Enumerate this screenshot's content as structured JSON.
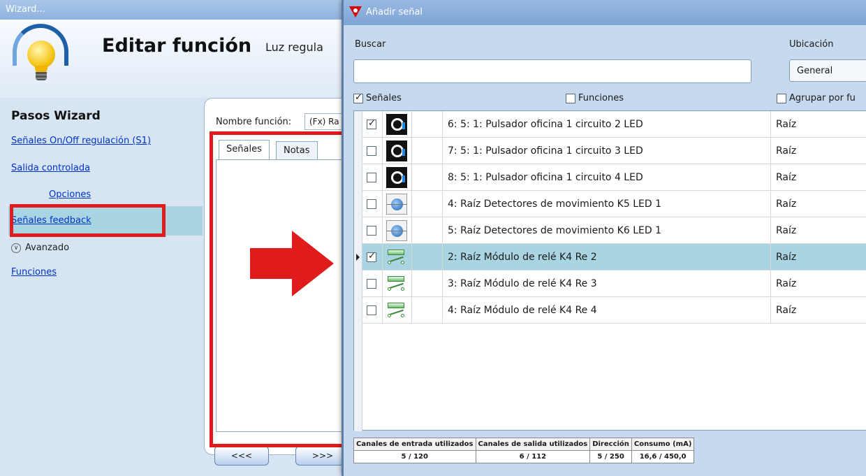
{
  "wizard": {
    "window_title": "Wizard...",
    "header_title": "Editar función",
    "header_subtitle": "Luz regula",
    "steps_title": "Pasos Wizard",
    "steps": [
      {
        "label": "Señales On/Off regulación (S1)"
      },
      {
        "label": "Salida controlada"
      },
      {
        "label": "Opciones"
      },
      {
        "label": "Señales feedback"
      }
    ],
    "advanced_label": "Avanzado",
    "functions_link": "Funciones",
    "function_name_label": "Nombre función:",
    "function_name_value": "(Fx) Ra",
    "tabs": [
      {
        "label": "Señales"
      },
      {
        "label": "Notas"
      }
    ],
    "back_button": "<<<",
    "next_button": ">>>"
  },
  "dialog": {
    "title": "Añadir señal",
    "search_label": "Buscar",
    "search_value": "",
    "location_label": "Ubicación",
    "location_value": "General",
    "filters": {
      "signals": {
        "label": "Señales",
        "checked": true
      },
      "functions": {
        "label": "Funciones",
        "checked": false
      },
      "group": {
        "label": "Agrupar por fu",
        "checked": false
      }
    },
    "rows": [
      {
        "checked": true,
        "icon": "pushbutton-icon",
        "name": "6: 5: 1: Pulsador oficina 1 circuito 2 LED",
        "location": "Raíz",
        "selected": false
      },
      {
        "checked": false,
        "icon": "pushbutton-icon",
        "name": "7: 5: 1: Pulsador oficina 1 circuito 3 LED",
        "location": "Raíz",
        "selected": false
      },
      {
        "checked": false,
        "icon": "pushbutton-icon",
        "name": "8: 5: 1: Pulsador oficina 1 circuito 4 LED",
        "location": "Raíz",
        "selected": false
      },
      {
        "checked": false,
        "icon": "motion-detector-icon",
        "name": "4: Raíz Detectores de movimiento K5 LED 1",
        "location": "Raíz",
        "selected": false
      },
      {
        "checked": false,
        "icon": "motion-detector-icon",
        "name": "5: Raíz Detectores de movimiento K6 LED 1",
        "location": "Raíz",
        "selected": false
      },
      {
        "checked": true,
        "icon": "relay-icon",
        "name": "2: Raíz Módulo de relé K4 Re 2",
        "location": "Raíz",
        "selected": true
      },
      {
        "checked": false,
        "icon": "relay-icon",
        "name": "3: Raíz Módulo de relé K4 Re 3",
        "location": "Raíz",
        "selected": false
      },
      {
        "checked": false,
        "icon": "relay-icon",
        "name": "4: Raíz Módulo de relé K4 Re 4",
        "location": "Raíz",
        "selected": false
      }
    ],
    "stats": {
      "headers": [
        "Canales de entrada utilizados",
        "Canales de salida utilizados",
        "Dirección",
        "Consumo (mA)"
      ],
      "values": [
        "5 / 120",
        "6 / 112",
        "5 / 250",
        "16,6 / 450,0"
      ]
    }
  },
  "colors": {
    "highlight_red": "#e01b1b",
    "selected_row": "#a9d4e2",
    "dialog_bg": "#c6d9ef",
    "link_blue": "#0033cc"
  }
}
